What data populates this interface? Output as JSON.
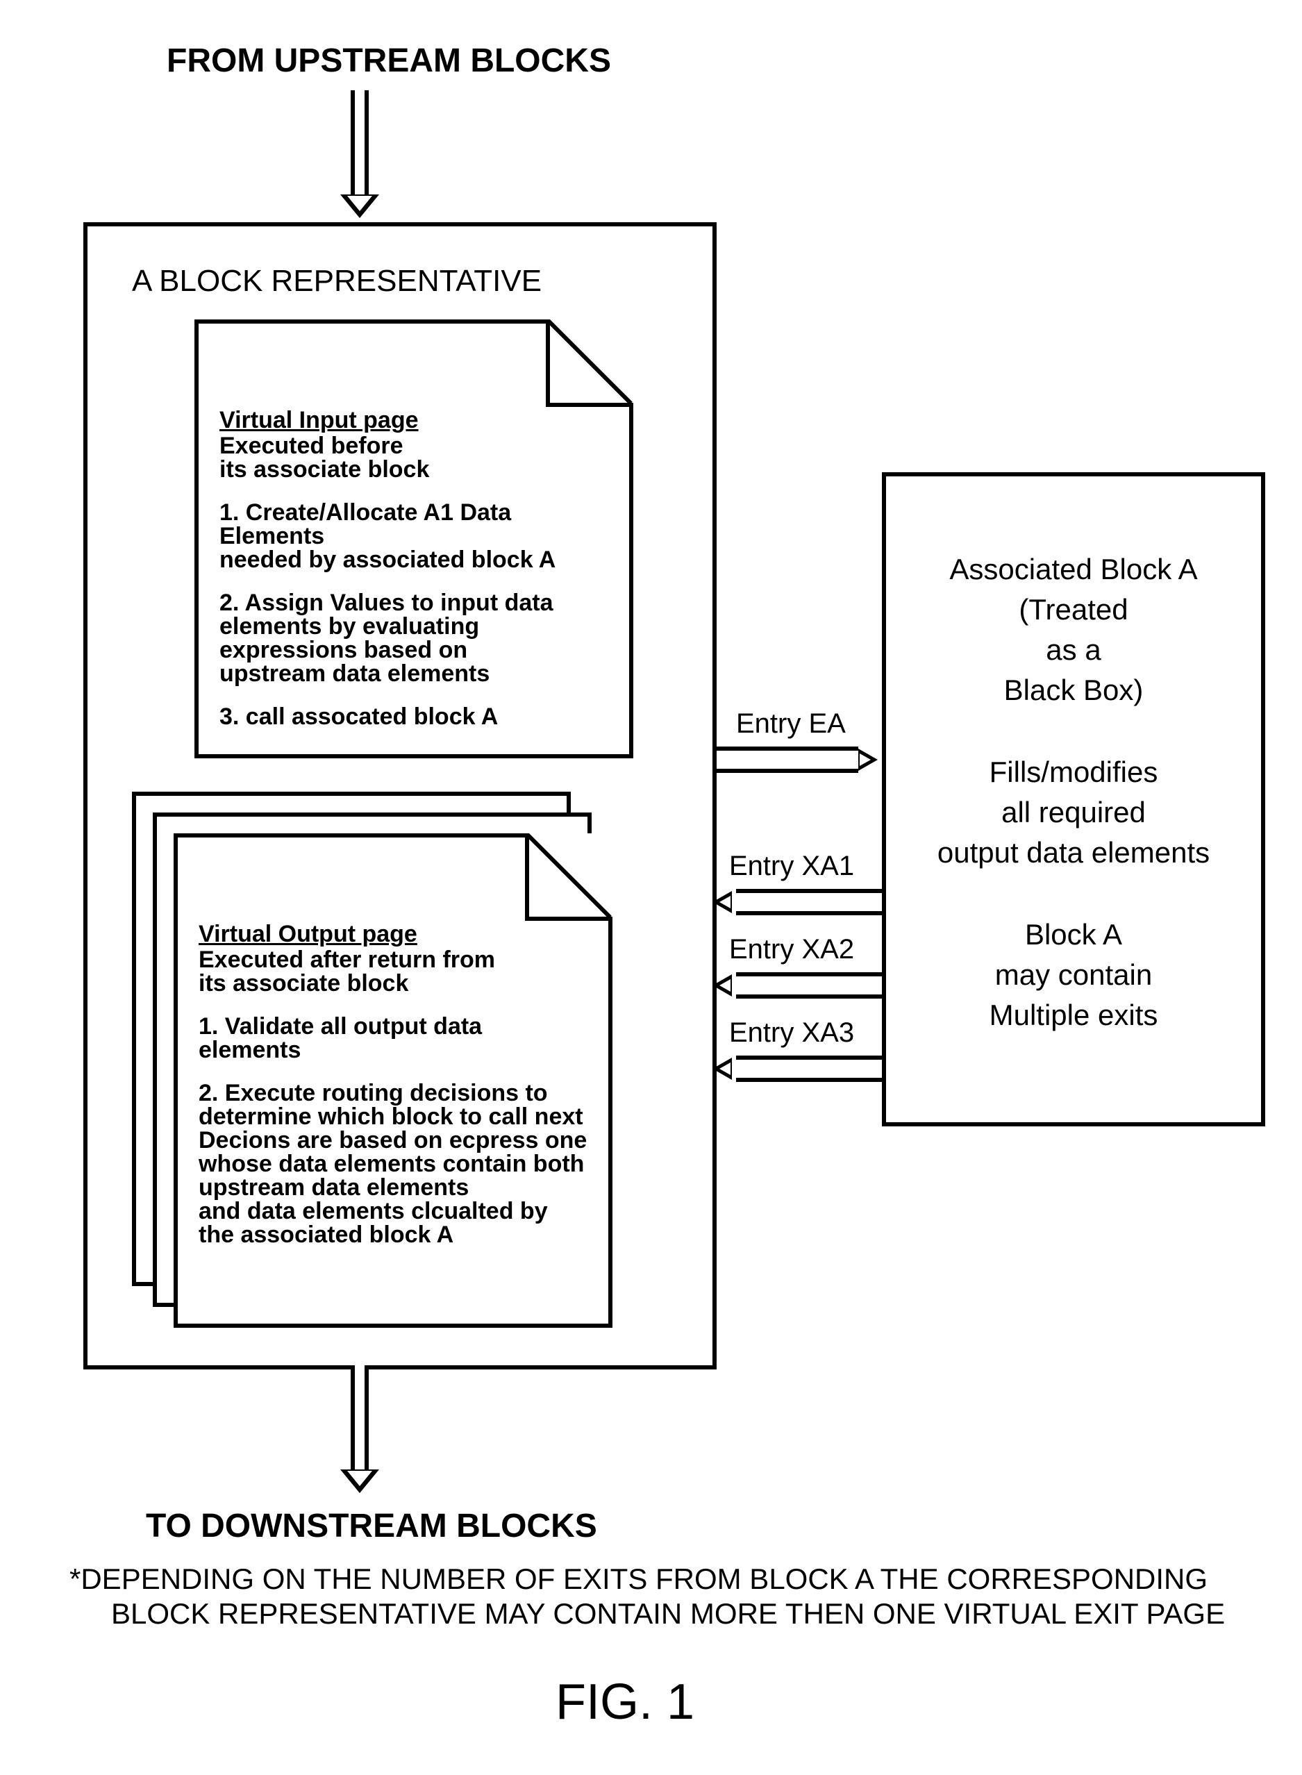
{
  "top_label": "FROM UPSTREAM BLOCKS",
  "bottom_label": "TO DOWNSTREAM BLOCKS",
  "footnote_line1": "*DEPENDING ON THE NUMBER OF EXITS FROM BLOCK A THE CORRESPONDING",
  "footnote_line2": "BLOCK REPRESENTATIVE MAY CONTAIN MORE THEN ONE VIRTUAL EXIT PAGE",
  "figure_label": "FIG. 1",
  "block_rep_title": "A BLOCK REPRESENTATIVE",
  "input_page": {
    "title": "Virtual Input page",
    "subtitle_l1": "Executed before",
    "subtitle_l2": "its associate block",
    "item1_l1": "1. Create/Allocate A1 Data Elements",
    "item1_l2": "needed by associated block A",
    "item2_l1": "2. Assign Values to input data",
    "item2_l2": "elements by evaluating",
    "item2_l3": "expressions based on",
    "item2_l4": "upstream data elements",
    "item3_l1": "3. call assocated block A"
  },
  "output_page": {
    "title": "Virtual Output page",
    "subtitle_l1": "Executed after return from",
    "subtitle_l2": "its associate block",
    "item1_l1": "1. Validate all output data elements",
    "item2_l1": "2. Execute routing decisions to",
    "item2_l2": "determine which block to call next",
    "item2_l3": "Decions are based on ecpress one",
    "item2_l4": "whose data elements contain both",
    "item2_l5": "upstream data elements",
    "item2_l6": "and data elements clcualted by",
    "item2_l7": "the associated block A"
  },
  "assoc_block": {
    "l1": "Associated Block A",
    "l2": "(Treated",
    "l3": "as a",
    "l4": "Black Box)",
    "l5": "Fills/modifies",
    "l6": "all required",
    "l7": "output data elements",
    "l8": "Block A",
    "l9": "may contain",
    "l10": "Multiple exits"
  },
  "arrows": {
    "ea": "Entry EA",
    "xa1": "Entry XA1",
    "xa2": "Entry XA2",
    "xa3": "Entry XA3"
  }
}
